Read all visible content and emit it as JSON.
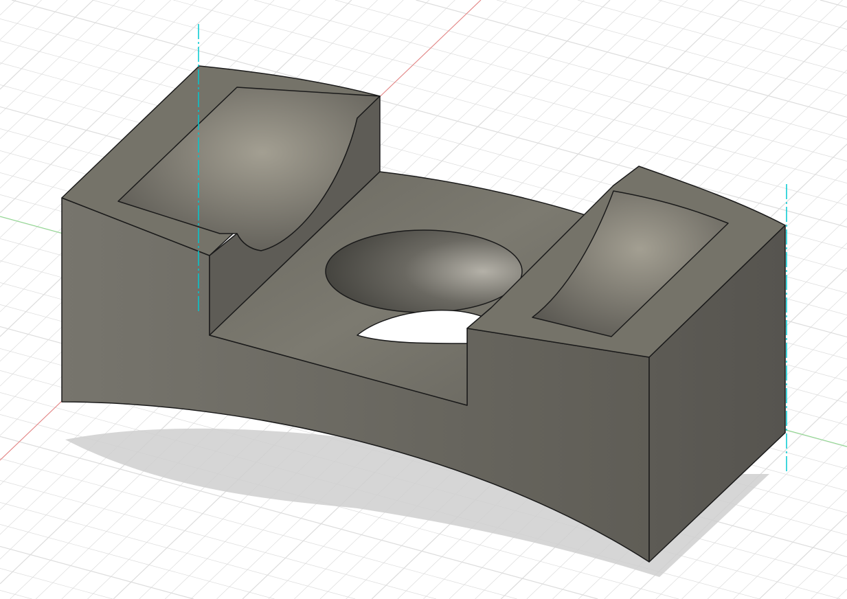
{
  "viewport": {
    "background": "#ffffff",
    "grid_color": "#dcdcdc",
    "x_axis_color": "#e06060",
    "y_axis_color": "#70d070",
    "z_axis_color": "#00c8d0"
  },
  "model": {
    "body_color": "#6e6c64",
    "edge_color": "#1a1a1a"
  }
}
